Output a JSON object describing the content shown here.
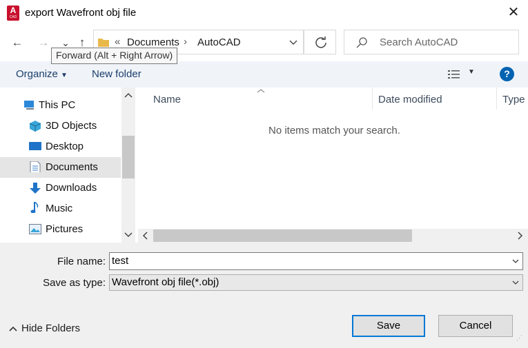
{
  "window": {
    "title": "export Wavefront obj file",
    "app_icon_letter": "A",
    "app_icon_sub": "CAD"
  },
  "nav": {
    "back": "←",
    "forward": "→",
    "recent": "⌄",
    "up": "↑"
  },
  "tooltip": "Forward (Alt + Right Arrow)",
  "address": {
    "overflow": "«",
    "crumbs": [
      "Documents",
      "AutoCAD"
    ],
    "separator": "›"
  },
  "search": {
    "placeholder": "Search AutoCAD"
  },
  "toolbar": {
    "organize": "Organize",
    "new_folder": "New folder"
  },
  "tree": {
    "items": [
      {
        "label": "This PC",
        "icon": "computer-icon"
      },
      {
        "label": "3D Objects",
        "icon": "3d-objects-icon"
      },
      {
        "label": "Desktop",
        "icon": "desktop-icon"
      },
      {
        "label": "Documents",
        "icon": "documents-icon",
        "selected": true
      },
      {
        "label": "Downloads",
        "icon": "downloads-icon"
      },
      {
        "label": "Music",
        "icon": "music-icon"
      },
      {
        "label": "Pictures",
        "icon": "pictures-icon"
      }
    ]
  },
  "columns": {
    "name": "Name",
    "date_modified": "Date modified",
    "type": "Type"
  },
  "empty_message": "No items match your search.",
  "form": {
    "file_name_label": "File name:",
    "file_name_value": "test",
    "save_type_label": "Save as type:",
    "save_type_value": "Wavefront obj file(*.obj)"
  },
  "footer": {
    "hide_folders": "Hide Folders",
    "save": "Save",
    "cancel": "Cancel"
  },
  "colors": {
    "accent": "#0078d7",
    "brand": "#c8102e",
    "help": "#0063b1"
  }
}
